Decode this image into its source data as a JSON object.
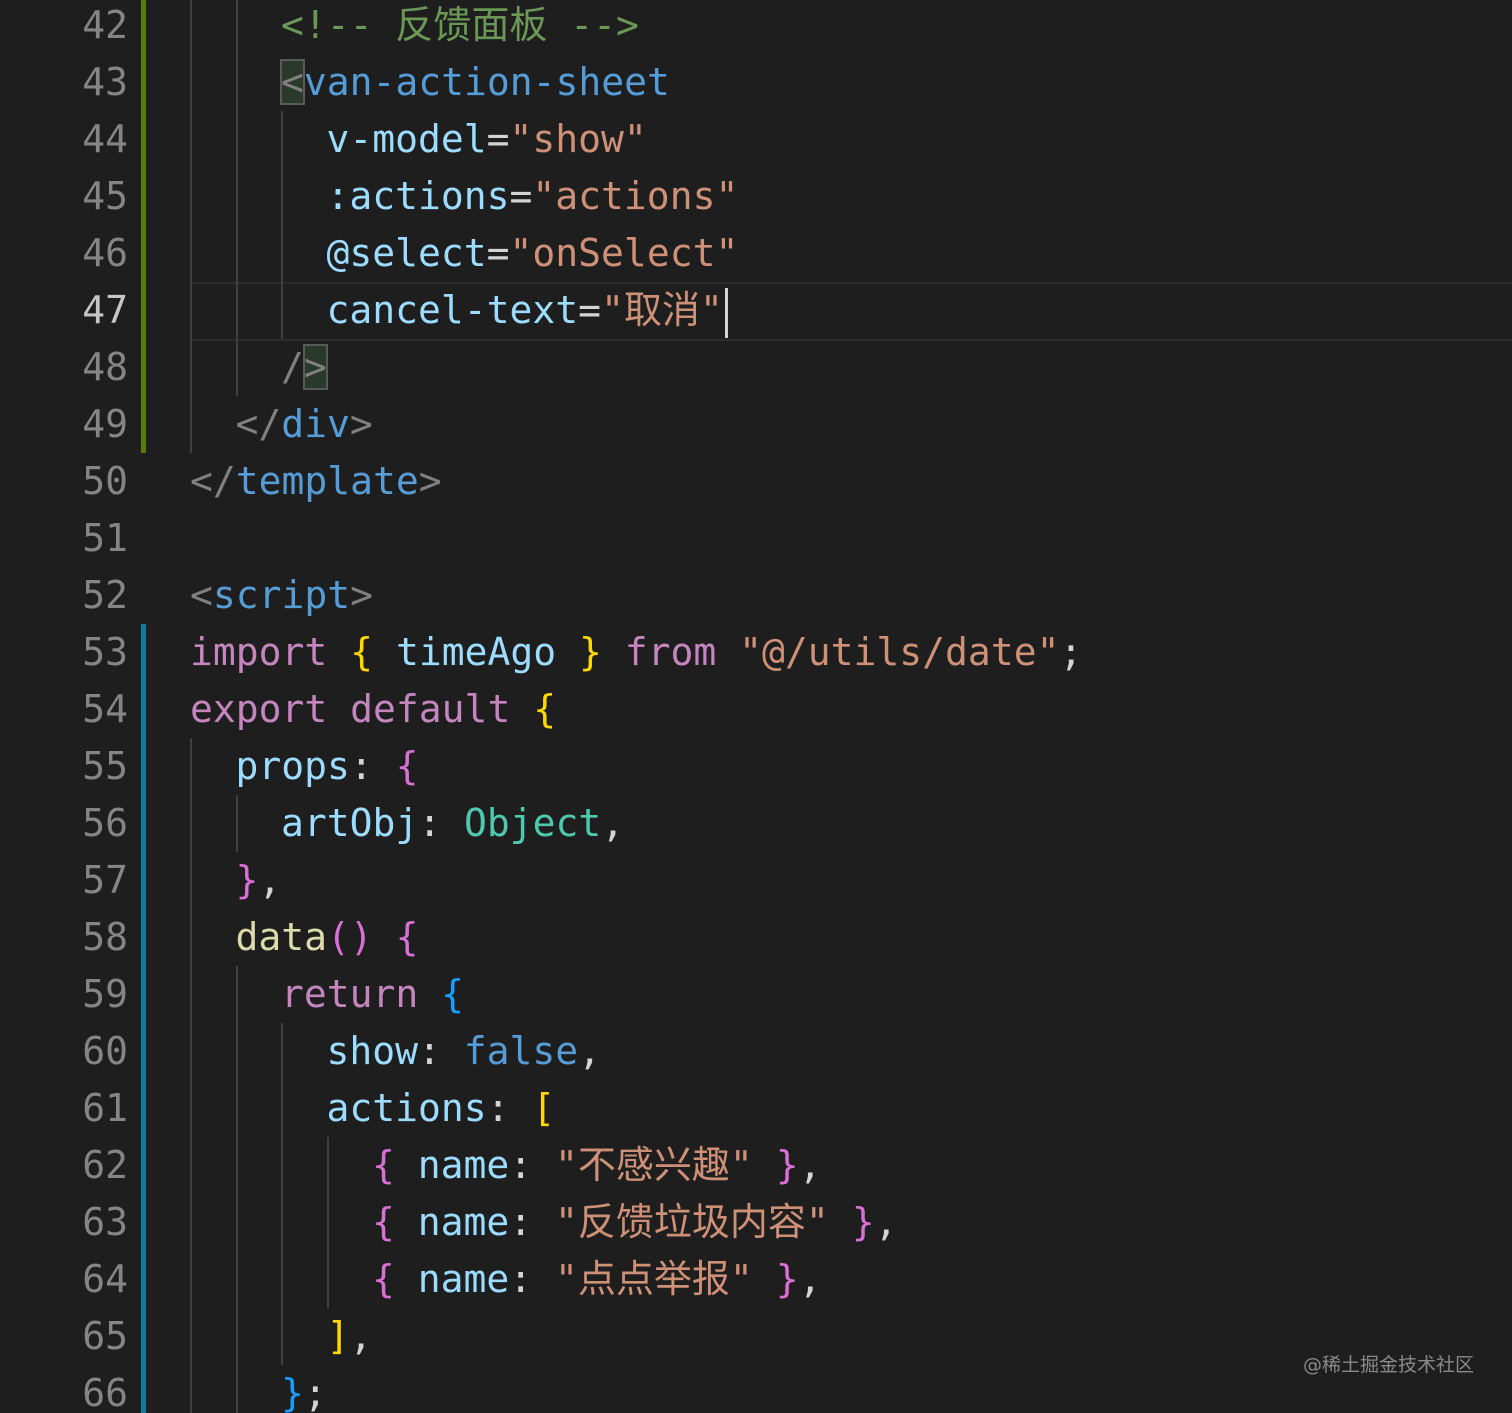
{
  "editor": {
    "active_line": 47,
    "colors": {
      "background": "#1e1e1e",
      "template_gutter_marker": "#587c0c",
      "script_gutter_marker": "#0c7d9d"
    },
    "lines": [
      {
        "n": "42",
        "ind": 2,
        "tokens": [
          {
            "t": "<!-- 反馈面板 -->",
            "c": "comment"
          }
        ]
      },
      {
        "n": "43",
        "ind": 2,
        "tokens": [
          {
            "t": "<",
            "c": "punc",
            "box": true
          },
          {
            "t": "van-action-sheet",
            "c": "tag"
          }
        ]
      },
      {
        "n": "44",
        "ind": 3,
        "tokens": [
          {
            "t": "v-model",
            "c": "attr"
          },
          {
            "t": "=",
            "c": "plain"
          },
          {
            "t": "\"show\"",
            "c": "str"
          }
        ]
      },
      {
        "n": "45",
        "ind": 3,
        "tokens": [
          {
            "t": ":actions",
            "c": "attr"
          },
          {
            "t": "=",
            "c": "plain"
          },
          {
            "t": "\"actions\"",
            "c": "str"
          }
        ]
      },
      {
        "n": "46",
        "ind": 3,
        "tokens": [
          {
            "t": "@select",
            "c": "attr"
          },
          {
            "t": "=",
            "c": "plain"
          },
          {
            "t": "\"onSelect\"",
            "c": "str"
          }
        ]
      },
      {
        "n": "47",
        "ind": 3,
        "tokens": [
          {
            "t": "cancel-text",
            "c": "attr"
          },
          {
            "t": "=",
            "c": "plain"
          },
          {
            "t": "\"取消\"",
            "c": "str"
          }
        ],
        "cursor": true
      },
      {
        "n": "48",
        "ind": 2,
        "tokens": [
          {
            "t": "/",
            "c": "punc"
          },
          {
            "t": ">",
            "c": "punc",
            "box": true
          }
        ]
      },
      {
        "n": "49",
        "ind": 1,
        "tokens": [
          {
            "t": "</",
            "c": "punc"
          },
          {
            "t": "div",
            "c": "tag"
          },
          {
            "t": ">",
            "c": "punc"
          }
        ]
      },
      {
        "n": "50",
        "ind": 0,
        "tokens": [
          {
            "t": "</",
            "c": "punc"
          },
          {
            "t": "template",
            "c": "tag"
          },
          {
            "t": ">",
            "c": "punc"
          }
        ]
      },
      {
        "n": "51",
        "ind": 0,
        "tokens": []
      },
      {
        "n": "52",
        "ind": 0,
        "tokens": [
          {
            "t": "<",
            "c": "punc"
          },
          {
            "t": "script",
            "c": "tag"
          },
          {
            "t": ">",
            "c": "punc"
          }
        ]
      },
      {
        "n": "53",
        "ind": 0,
        "tokens": [
          {
            "t": "import",
            "c": "kw"
          },
          {
            "t": " ",
            "c": "plain"
          },
          {
            "t": "{",
            "c": "br1"
          },
          {
            "t": " timeAgo ",
            "c": "ident"
          },
          {
            "t": "}",
            "c": "br1"
          },
          {
            "t": " ",
            "c": "plain"
          },
          {
            "t": "from",
            "c": "kw"
          },
          {
            "t": " ",
            "c": "plain"
          },
          {
            "t": "\"@/utils/date\"",
            "c": "str"
          },
          {
            "t": ";",
            "c": "plain"
          }
        ]
      },
      {
        "n": "54",
        "ind": 0,
        "tokens": [
          {
            "t": "export",
            "c": "kw"
          },
          {
            "t": " ",
            "c": "plain"
          },
          {
            "t": "default",
            "c": "kw"
          },
          {
            "t": " ",
            "c": "plain"
          },
          {
            "t": "{",
            "c": "br1"
          }
        ]
      },
      {
        "n": "55",
        "ind": 1,
        "tokens": [
          {
            "t": "props",
            "c": "ident"
          },
          {
            "t": ": ",
            "c": "plain"
          },
          {
            "t": "{",
            "c": "br2"
          }
        ]
      },
      {
        "n": "56",
        "ind": 2,
        "tokens": [
          {
            "t": "artObj",
            "c": "ident"
          },
          {
            "t": ": ",
            "c": "plain"
          },
          {
            "t": "Object",
            "c": "class"
          },
          {
            "t": ",",
            "c": "plain"
          }
        ]
      },
      {
        "n": "57",
        "ind": 1,
        "tokens": [
          {
            "t": "}",
            "c": "br2"
          },
          {
            "t": ",",
            "c": "plain"
          }
        ]
      },
      {
        "n": "58",
        "ind": 1,
        "tokens": [
          {
            "t": "data",
            "c": "fn"
          },
          {
            "t": "()",
            "c": "br2"
          },
          {
            "t": " ",
            "c": "plain"
          },
          {
            "t": "{",
            "c": "br2"
          }
        ]
      },
      {
        "n": "59",
        "ind": 2,
        "tokens": [
          {
            "t": "return",
            "c": "kw"
          },
          {
            "t": " ",
            "c": "plain"
          },
          {
            "t": "{",
            "c": "br3"
          }
        ]
      },
      {
        "n": "60",
        "ind": 3,
        "tokens": [
          {
            "t": "show",
            "c": "ident"
          },
          {
            "t": ": ",
            "c": "plain"
          },
          {
            "t": "false",
            "c": "bool"
          },
          {
            "t": ",",
            "c": "plain"
          }
        ]
      },
      {
        "n": "61",
        "ind": 3,
        "tokens": [
          {
            "t": "actions",
            "c": "ident"
          },
          {
            "t": ": ",
            "c": "plain"
          },
          {
            "t": "[",
            "c": "br1"
          }
        ]
      },
      {
        "n": "62",
        "ind": 4,
        "tokens": [
          {
            "t": "{",
            "c": "br2"
          },
          {
            "t": " name",
            "c": "ident"
          },
          {
            "t": ": ",
            "c": "plain"
          },
          {
            "t": "\"不感兴趣\"",
            "c": "str"
          },
          {
            "t": " ",
            "c": "plain"
          },
          {
            "t": "}",
            "c": "br2"
          },
          {
            "t": ",",
            "c": "plain"
          }
        ]
      },
      {
        "n": "63",
        "ind": 4,
        "tokens": [
          {
            "t": "{",
            "c": "br2"
          },
          {
            "t": " name",
            "c": "ident"
          },
          {
            "t": ": ",
            "c": "plain"
          },
          {
            "t": "\"反馈垃圾内容\"",
            "c": "str"
          },
          {
            "t": " ",
            "c": "plain"
          },
          {
            "t": "}",
            "c": "br2"
          },
          {
            "t": ",",
            "c": "plain"
          }
        ]
      },
      {
        "n": "64",
        "ind": 4,
        "tokens": [
          {
            "t": "{",
            "c": "br2"
          },
          {
            "t": " name",
            "c": "ident"
          },
          {
            "t": ": ",
            "c": "plain"
          },
          {
            "t": "\"点点举报\"",
            "c": "str"
          },
          {
            "t": " ",
            "c": "plain"
          },
          {
            "t": "}",
            "c": "br2"
          },
          {
            "t": ",",
            "c": "plain"
          }
        ]
      },
      {
        "n": "65",
        "ind": 3,
        "tokens": [
          {
            "t": "]",
            "c": "br1"
          },
          {
            "t": ",",
            "c": "plain"
          }
        ]
      },
      {
        "n": "66",
        "ind": 2,
        "tokens": [
          {
            "t": "}",
            "c": "br3"
          },
          {
            "t": ";",
            "c": "plain"
          }
        ]
      }
    ]
  },
  "watermark": "@稀土掘金技术社区"
}
